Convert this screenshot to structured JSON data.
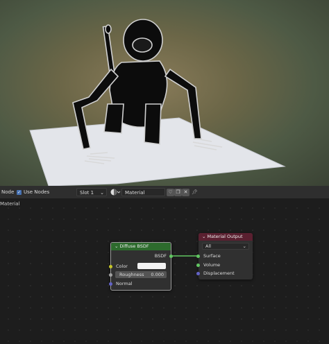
{
  "header": {
    "editor_label": "Node",
    "use_nodes_label": "Use Nodes",
    "use_nodes_checked": true,
    "slot_value": "Slot 1",
    "material_name": "Material"
  },
  "breadcrumb": "Material",
  "nodes": {
    "diffuse": {
      "title": "Diffuse BSDF",
      "output_label": "BSDF",
      "color_label": "Color",
      "color_value": "#f2f2f2",
      "roughness_label": "Roughness",
      "roughness_value": "0.000",
      "normal_label": "Normal",
      "header_color": "#2d6b2d"
    },
    "output": {
      "title": "Material Output",
      "target_value": "All",
      "surface_label": "Surface",
      "volume_label": "Volume",
      "displacement_label": "Displacement",
      "header_color": "#5a2030"
    }
  },
  "icons": [
    "chevron-down-icon",
    "material-sphere-icon",
    "shield-icon",
    "duplicate-icon",
    "close-icon",
    "pin-icon"
  ]
}
